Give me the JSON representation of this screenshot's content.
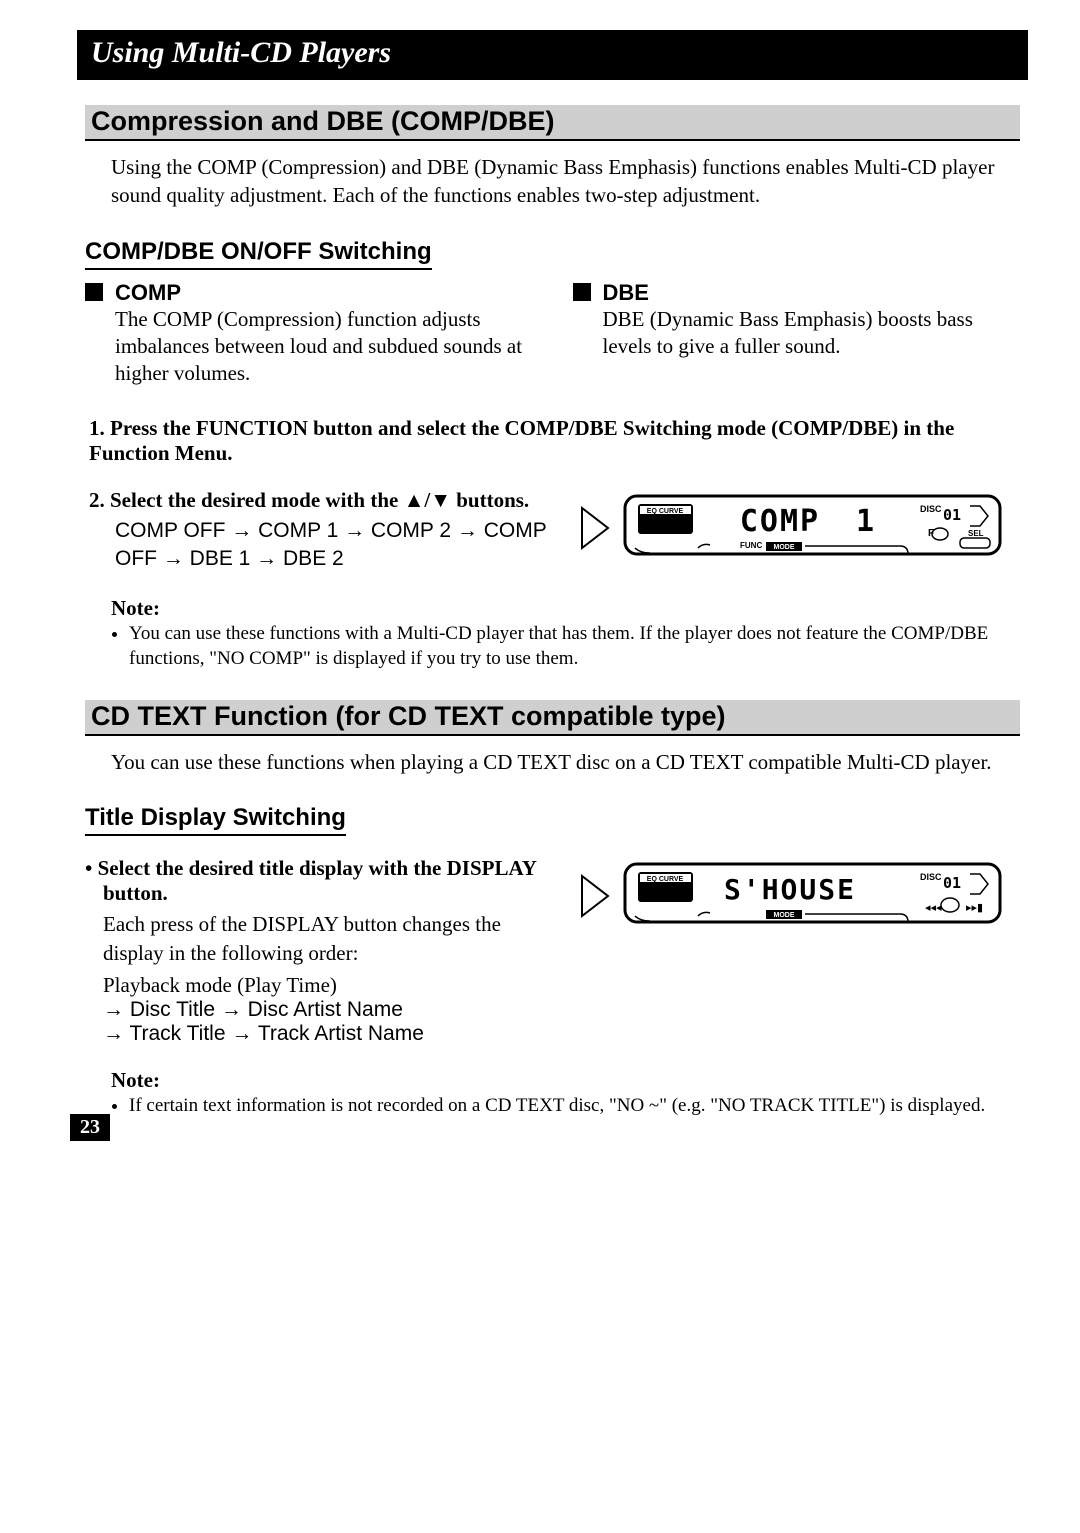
{
  "pageNumber": "23",
  "titleBar": "Using Multi-CD Players",
  "s1": {
    "heading": "Compression and DBE (COMP/DBE)",
    "intro": "Using the COMP (Compression) and DBE (Dynamic Bass Emphasis) functions enables Multi-CD player sound quality adjustment. Each of the functions enables two-step adjustment.",
    "sub": "COMP/DBE ON/OFF Switching",
    "comp": {
      "title": "COMP",
      "body": "The COMP (Compression) function adjusts imbalances between loud and subdued sounds at higher volumes."
    },
    "dbe": {
      "title": "DBE",
      "body": "DBE (Dynamic Bass Emphasis) boosts bass levels to give a fuller sound."
    },
    "step1": {
      "num": "1.",
      "head": "Press the FUNCTION button and select the COMP/DBE Switching mode (COMP/DBE) in the Function Menu."
    },
    "step2": {
      "num": "2.",
      "head": "Select the desired mode with the ▲/▼ buttons.",
      "body": "COMP OFF → COMP 1 → COMP 2 → COMP OFF → DBE 1 → DBE 2"
    },
    "lcd1": {
      "eq": "EQ CURVE",
      "main": "COMP",
      "right": "1",
      "disc": "DISC",
      "discNum": "01",
      "func": "FUNC",
      "mode": "MODE",
      "f": "F",
      "sel": "SEL"
    },
    "note": {
      "label": "Note:",
      "item": "You can use these functions with a Multi-CD player that has them. If the player does not feature the COMP/DBE functions, \"NO COMP\" is displayed if you try to use them."
    }
  },
  "s2": {
    "heading": "CD TEXT Function (for CD TEXT compatible type)",
    "intro": "You can use these functions when playing a CD TEXT disc on a CD TEXT compatible Multi-CD player.",
    "sub": "Title Display Switching",
    "bullet": {
      "head": "Select the desired title display with the DISPLAY button.",
      "body1": "Each press of the DISPLAY button changes the display in the following order:",
      "body2": "Playback mode (Play Time)",
      "body3": "→ Disc Title → Disc Artist Name",
      "body4": "→ Track Title → Track Artist Name"
    },
    "lcd2": {
      "eq": "EQ CURVE",
      "main": "S'HOUSE",
      "disc": "DISC",
      "discNum": "01",
      "mode": "MODE"
    },
    "note": {
      "label": "Note:",
      "item": "If certain text information is not recorded on a CD TEXT disc, \"NO ~\" (e.g. \"NO TRACK TITLE\") is displayed."
    }
  }
}
